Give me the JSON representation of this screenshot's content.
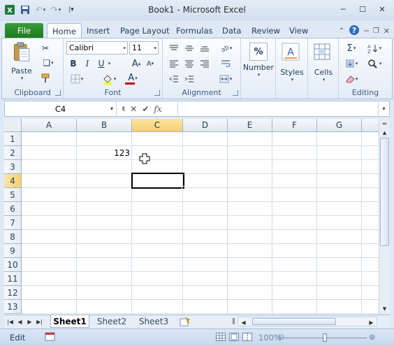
{
  "window": {
    "title": "Book1 - Microsoft Excel"
  },
  "tabs": {
    "file": "File",
    "items": [
      "Home",
      "Insert",
      "Page Layout",
      "Formulas",
      "Data",
      "Review",
      "View"
    ],
    "active": "Home"
  },
  "ribbon": {
    "clipboard": {
      "label": "Clipboard",
      "paste": "Paste"
    },
    "font": {
      "label": "Font",
      "family": "Calibri",
      "size": "11",
      "bold": "B",
      "italic": "I",
      "underline": "U",
      "grow": "A",
      "shrink": "A",
      "font_color_glyph": "A",
      "font_color": "#c00000"
    },
    "alignment": {
      "label": "Alignment"
    },
    "number": {
      "label": "Number",
      "symbol": "%"
    },
    "styles": {
      "label": "Styles"
    },
    "cells": {
      "label": "Cells"
    },
    "editing": {
      "label": "Editing"
    }
  },
  "formula_bar": {
    "name_box": "C4",
    "fx": "fx",
    "formula": ""
  },
  "grid": {
    "columns": [
      "A",
      "B",
      "C",
      "D",
      "E",
      "F",
      "G"
    ],
    "selected_column": "C",
    "rows": [
      "1",
      "2",
      "3",
      "4",
      "5",
      "6",
      "7",
      "8",
      "9",
      "10",
      "11",
      "12",
      "13"
    ],
    "selected_row": "4",
    "cells": {
      "B2": "123"
    },
    "active_cell": "C4"
  },
  "sheets": {
    "tabs": [
      "Sheet1",
      "Sheet2",
      "Sheet3"
    ],
    "active": "Sheet1"
  },
  "status": {
    "mode": "Edit",
    "zoom": "100%",
    "zoom_level": 1.0
  },
  "colors": {
    "file_tab": "#2a8a2a",
    "selection_header": "#f6cf6c"
  }
}
